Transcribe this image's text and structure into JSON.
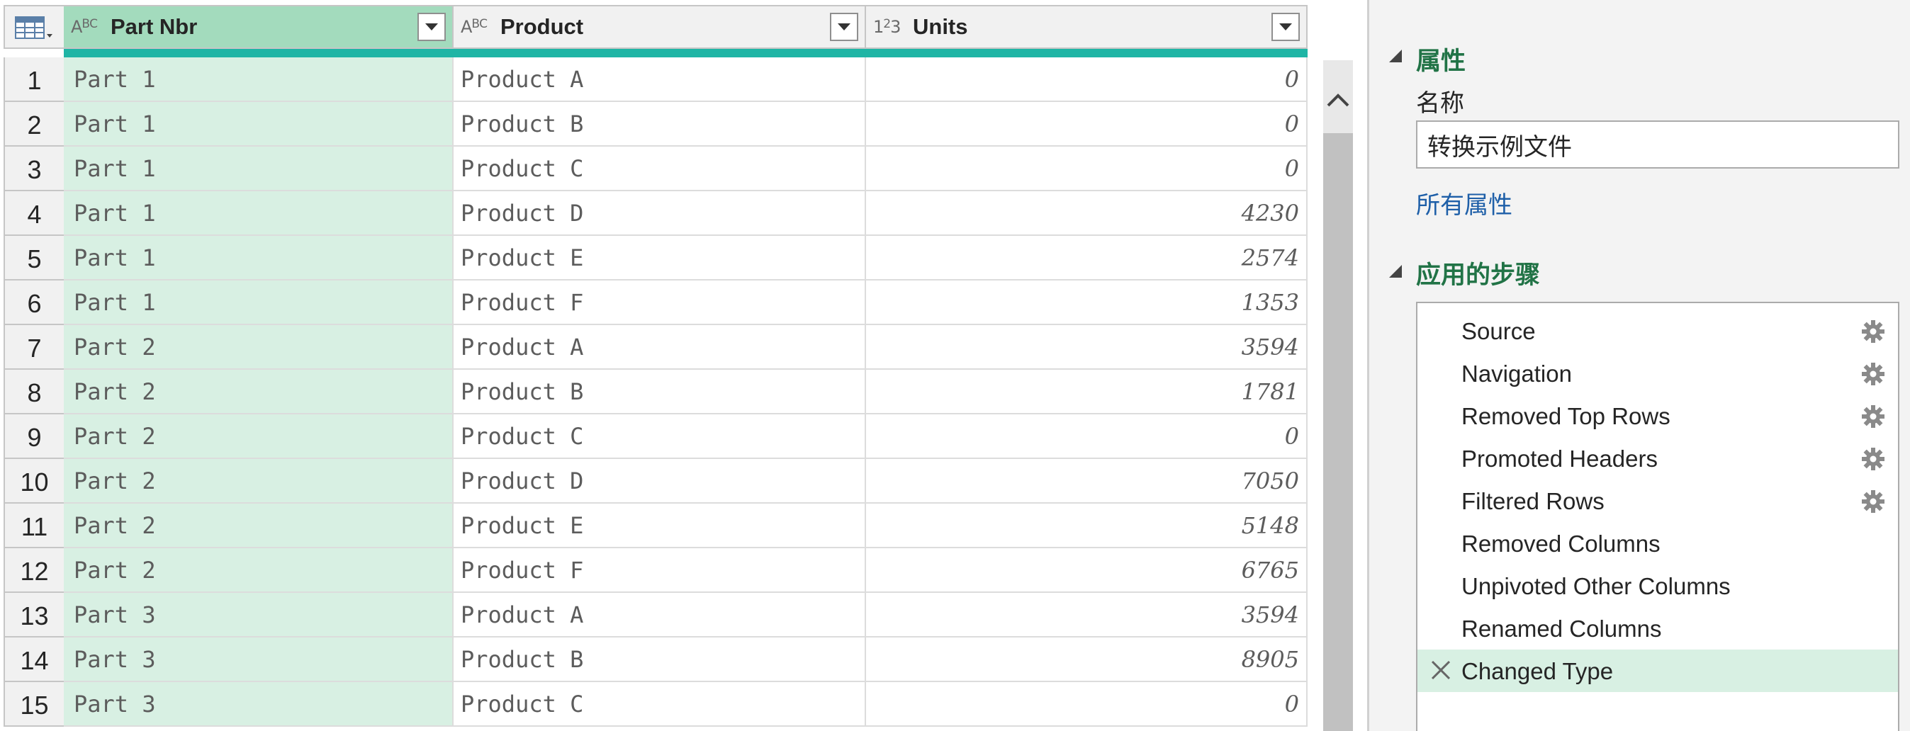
{
  "columns": [
    {
      "type_icon": "ABC",
      "name": "Part Nbr"
    },
    {
      "type_icon": "ABC",
      "name": "Product"
    },
    {
      "type_icon": "123",
      "name": "Units"
    }
  ],
  "rows": [
    {
      "num": "1",
      "part": "Part 1",
      "product": "Product A",
      "units": "0"
    },
    {
      "num": "2",
      "part": "Part 1",
      "product": "Product B",
      "units": "0"
    },
    {
      "num": "3",
      "part": "Part 1",
      "product": "Product C",
      "units": "0"
    },
    {
      "num": "4",
      "part": "Part 1",
      "product": "Product D",
      "units": "4230"
    },
    {
      "num": "5",
      "part": "Part 1",
      "product": "Product E",
      "units": "2574"
    },
    {
      "num": "6",
      "part": "Part 1",
      "product": "Product F",
      "units": "1353"
    },
    {
      "num": "7",
      "part": "Part 2",
      "product": "Product A",
      "units": "3594"
    },
    {
      "num": "8",
      "part": "Part 2",
      "product": "Product B",
      "units": "1781"
    },
    {
      "num": "9",
      "part": "Part 2",
      "product": "Product C",
      "units": "0"
    },
    {
      "num": "10",
      "part": "Part 2",
      "product": "Product D",
      "units": "7050"
    },
    {
      "num": "11",
      "part": "Part 2",
      "product": "Product E",
      "units": "5148"
    },
    {
      "num": "12",
      "part": "Part 2",
      "product": "Product F",
      "units": "6765"
    },
    {
      "num": "13",
      "part": "Part 3",
      "product": "Product A",
      "units": "3594"
    },
    {
      "num": "14",
      "part": "Part 3",
      "product": "Product B",
      "units": "8905"
    },
    {
      "num": "15",
      "part": "Part 3",
      "product": "Product C",
      "units": "0"
    }
  ],
  "properties": {
    "title": "属性",
    "name_label": "名称",
    "name_value": "转换示例文件",
    "all_properties_link": "所有属性"
  },
  "applied_steps": {
    "title": "应用的步骤",
    "steps": [
      {
        "label": "Source",
        "has_gear": true,
        "active": false
      },
      {
        "label": "Navigation",
        "has_gear": true,
        "active": false
      },
      {
        "label": "Removed Top Rows",
        "has_gear": true,
        "active": false
      },
      {
        "label": "Promoted Headers",
        "has_gear": true,
        "active": false
      },
      {
        "label": "Filtered Rows",
        "has_gear": true,
        "active": false
      },
      {
        "label": "Removed Columns",
        "has_gear": false,
        "active": false
      },
      {
        "label": "Unpivoted Other Columns",
        "has_gear": false,
        "active": false
      },
      {
        "label": "Renamed Columns",
        "has_gear": false,
        "active": false
      },
      {
        "label": "Changed Type",
        "has_gear": false,
        "active": true
      }
    ]
  },
  "colors": {
    "selected_column": "#d8f0e3",
    "selected_header": "#a3dbbd",
    "accent_bar": "#1fb5a5",
    "section_title": "#217346",
    "link": "#1e5fa8"
  },
  "icons": {
    "table_menu": "table-icon",
    "dropdown": "chevron-down-icon",
    "scroll_up": "chevron-up-icon",
    "collapse": "triangle-collapse-icon",
    "step_settings": "gear-icon",
    "delete_step": "close-icon"
  }
}
